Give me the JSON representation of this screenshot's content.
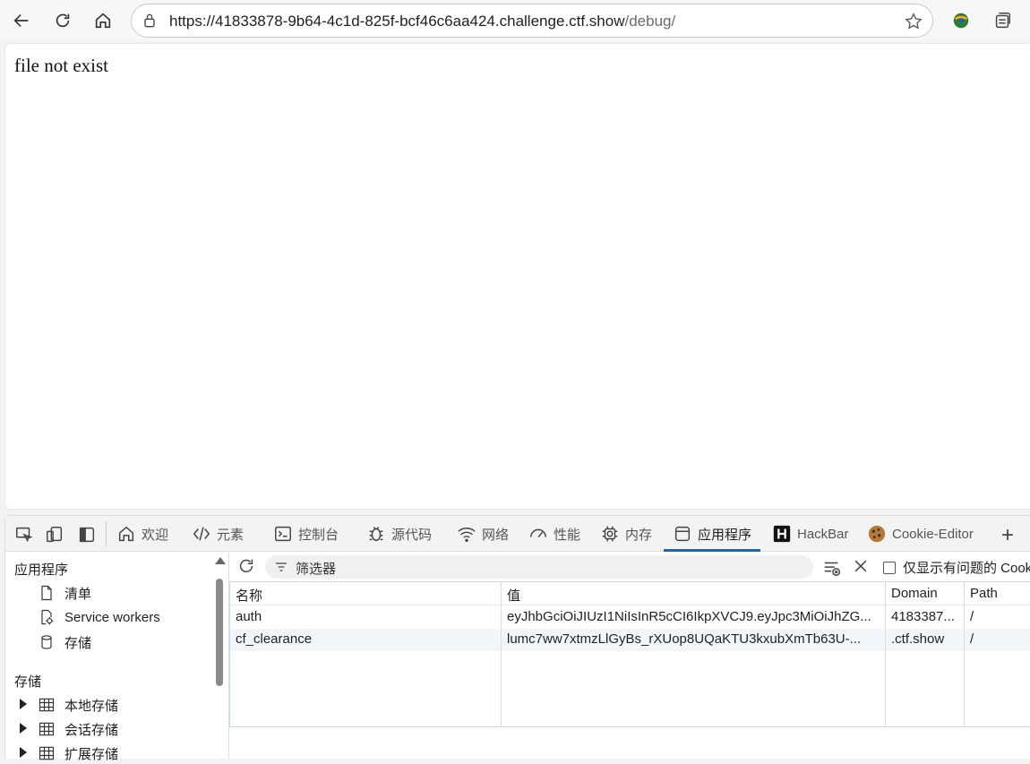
{
  "browser": {
    "url_main": "https://41833878-9b64-4c1d-825f-bcf46c6aa424.challenge.ctf.show",
    "url_path": "/debug/"
  },
  "page": {
    "body_text": "file not exist"
  },
  "devtools": {
    "tabs": [
      {
        "label": "欢迎"
      },
      {
        "label": "元素"
      },
      {
        "label": "控制台"
      },
      {
        "label": "源代码"
      },
      {
        "label": "网络"
      },
      {
        "label": "性能"
      },
      {
        "label": "内存"
      },
      {
        "label": "应用程序"
      },
      {
        "label": "HackBar"
      },
      {
        "label": "Cookie-Editor"
      }
    ],
    "active_tab": "应用程序",
    "sidebar": {
      "section_app": "应用程序",
      "app_items": [
        {
          "label": "清单",
          "icon": "file-icon"
        },
        {
          "label": "Service workers",
          "icon": "gear-icon"
        },
        {
          "label": "存储",
          "icon": "database-icon"
        }
      ],
      "section_storage": "存储",
      "storage_items": [
        {
          "label": "本地存储",
          "icon": "grid-icon"
        },
        {
          "label": "会话存储",
          "icon": "grid-icon"
        },
        {
          "label": "扩展存储",
          "icon": "grid-icon"
        }
      ]
    },
    "cookies": {
      "filter_placeholder": "筛选器",
      "only_issues_label": "仅显示有问题的 Cook",
      "columns": [
        "名称",
        "值",
        "Domain",
        "Path"
      ],
      "rows": [
        {
          "name": "auth",
          "value": "eyJhbGciOiJIUzI1NiIsInR5cCI6IkpXVCJ9.eyJpc3MiOiJhZG...",
          "domain": "4183387...",
          "path": "/"
        },
        {
          "name": "cf_clearance",
          "value": "lumc7ww7xtmzLlGyBs_rXUop8UQaKTU3kxubXmTb63U-...",
          "domain": ".ctf.show",
          "path": "/"
        }
      ]
    },
    "accent_color": "#0f6cbd"
  }
}
